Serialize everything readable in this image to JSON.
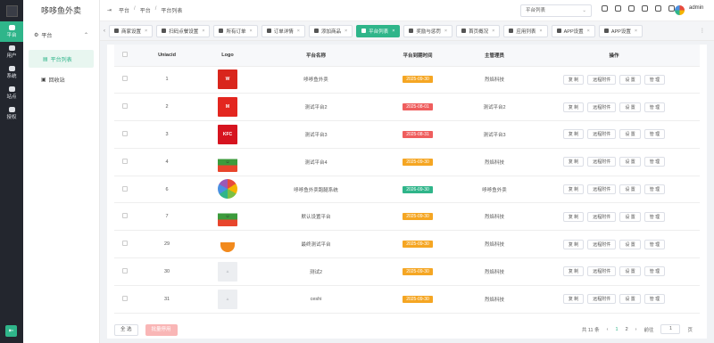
{
  "rail": {
    "items": [
      {
        "label": "平台",
        "active": true
      },
      {
        "label": "用户"
      },
      {
        "label": "系统"
      },
      {
        "label": "站点"
      },
      {
        "label": "授权"
      }
    ]
  },
  "brand": "哆哆鱼外卖",
  "menu": {
    "group": "平台",
    "active": "平台列表",
    "item2": "回收站"
  },
  "breadcrumb": [
    "平台",
    "平台",
    "平台列表"
  ],
  "topbar": {
    "select": "平台列表",
    "user": "admin"
  },
  "tabs": [
    "商家设置",
    "扫码点餐设置",
    "所有订单",
    "订单详情",
    "添加商品",
    "平台列表",
    "奖励与惩罚",
    "首页概况",
    "应用列表",
    "APP设置",
    "APP设置"
  ],
  "table": {
    "headers": [
      "Uniacid",
      "Logo",
      "平台名称",
      "平台到期时间",
      "主管理员",
      "操作"
    ],
    "actions": [
      "复 制",
      "远程附件",
      "设 置",
      "管 理"
    ],
    "rows": [
      {
        "id": "1",
        "logo": "hualaishi",
        "name": "哆哆鱼外卖",
        "expire": "2025-09-30",
        "status": "orange",
        "admin": "烈焰科技"
      },
      {
        "id": "2",
        "logo": "meiwei",
        "name": "测试平台2",
        "expire": "2025-08-01",
        "status": "red",
        "admin": "测试平台2"
      },
      {
        "id": "3",
        "logo": "kfc",
        "name": "测试平台3",
        "expire": "2025-08-31",
        "status": "red",
        "admin": "测试平台3"
      },
      {
        "id": "4",
        "logo": "cartoon",
        "name": "测试平台4",
        "expire": "2025-09-30",
        "status": "orange",
        "admin": "烈焰科技"
      },
      {
        "id": "6",
        "logo": "flower",
        "name": "哆哆鱼外卖跑腿系统",
        "expire": "2026-09-30",
        "status": "green",
        "admin": "哆哆鱼外卖"
      },
      {
        "id": "7",
        "logo": "cartoon",
        "name": "默认设置平台",
        "expire": "2025-09-30",
        "status": "orange",
        "admin": "烈焰科技"
      },
      {
        "id": "29",
        "logo": "bowl",
        "name": "最终测试平台",
        "expire": "2025-09-30",
        "status": "orange",
        "admin": "烈焰科技"
      },
      {
        "id": "30",
        "logo": "placeholder",
        "name": "测试2",
        "expire": "2025-09-30",
        "status": "orange",
        "admin": "烈焰科技"
      },
      {
        "id": "31",
        "logo": "placeholder",
        "name": "ceshi",
        "expire": "2025-09-30",
        "status": "orange",
        "admin": "烈焰科技"
      }
    ]
  },
  "footer": {
    "select_all": "全 选",
    "batch": "批量停用",
    "total": "共 11 条",
    "pages": [
      "1",
      "2"
    ],
    "goto_label": "前往",
    "goto_value": "1",
    "page_unit": "页"
  },
  "colors": {
    "accent": "#2fb58a",
    "orange": "#f5a623",
    "red": "#ef5e5e",
    "green": "#2fb58a"
  }
}
